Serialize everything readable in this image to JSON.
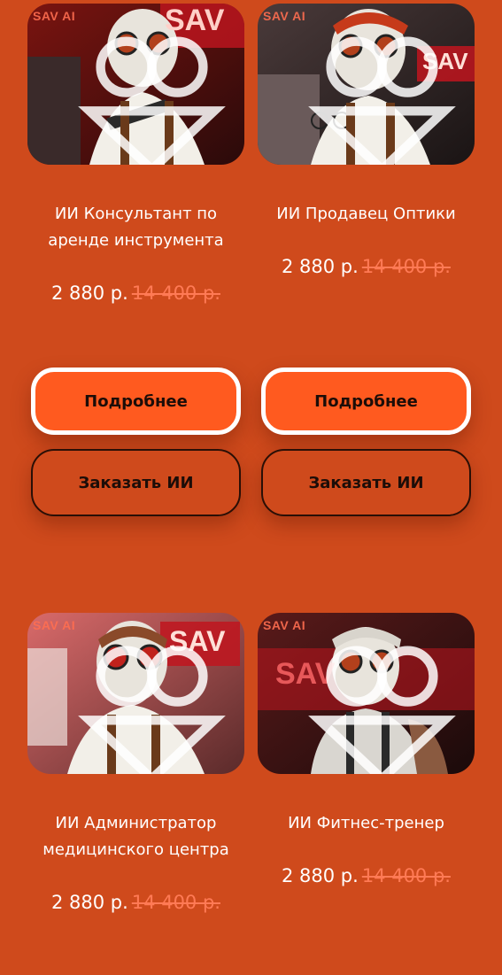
{
  "watermark": "SAV AI",
  "currency_note": "р.",
  "cards": [
    {
      "title_line1": "ИИ Консультант по",
      "title_line2": "аренде инструмента",
      "price": "2 880 р.",
      "old_price": "14 400 р.",
      "details_label": "Подробнее",
      "order_label": "Заказать ИИ",
      "image_sign": "SAV"
    },
    {
      "title_line1": "ИИ Продавец Оптики",
      "title_line2": "",
      "price": "2 880 р.",
      "old_price": "14 400 р.",
      "details_label": "Подробнее",
      "order_label": "Заказать ИИ",
      "image_sign": "SAV"
    },
    {
      "title_line1": "ИИ Администратор",
      "title_line2": "медицинского центра",
      "price": "2 880 р.",
      "old_price": "14 400 р.",
      "image_sign": "SAV"
    },
    {
      "title_line1": "ИИ Фитнес-тренер",
      "title_line2": "",
      "price": "2 880 р.",
      "old_price": "14 400 р.",
      "image_sign": "SAV"
    }
  ],
  "colors": {
    "background": "#cf4a1c",
    "primary_button": "#ff5a1f",
    "old_price": "#ff7a55"
  }
}
